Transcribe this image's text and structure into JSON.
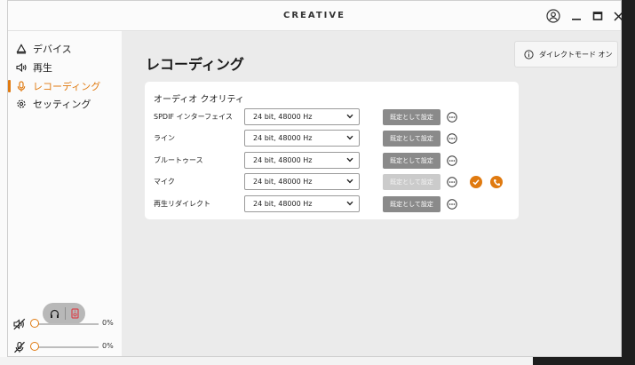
{
  "app": {
    "logo": "CREATIVE"
  },
  "sidebar": {
    "items": [
      {
        "label": "デバイス",
        "icon": "device-icon"
      },
      {
        "label": "再生",
        "icon": "speaker-icon"
      },
      {
        "label": "レコーディング",
        "icon": "microphone-icon",
        "active": true
      },
      {
        "label": "セッティング",
        "icon": "gear-icon"
      }
    ],
    "volumes": [
      {
        "icon": "speaker-muted-icon",
        "value": "0%",
        "level": 0
      },
      {
        "icon": "microphone-muted-icon",
        "value": "0%",
        "level": 0
      }
    ]
  },
  "main": {
    "title": "レコーディング",
    "direct_mode_label": "ダイレクトモード オン",
    "section_title": "オーディオ クオリティ",
    "default_label": "既定として設定",
    "rows": [
      {
        "label": "SPDIF インターフェイス",
        "value": "24 bit, 48000 Hz",
        "default_enabled": true
      },
      {
        "label": "ライン",
        "value": "24 bit, 48000 Hz",
        "default_enabled": true
      },
      {
        "label": "ブルートゥース",
        "value": "24 bit, 48000 Hz",
        "default_enabled": true
      },
      {
        "label": "マイク",
        "value": "24 bit, 48000 Hz",
        "default_enabled": false
      },
      {
        "label": "再生リダイレクト",
        "value": "24 bit, 48000 Hz",
        "default_enabled": true
      }
    ]
  },
  "colors": {
    "accent": "#e07a10",
    "button_gray": "#8a8a8a",
    "button_disabled": "#cbcbcb"
  }
}
